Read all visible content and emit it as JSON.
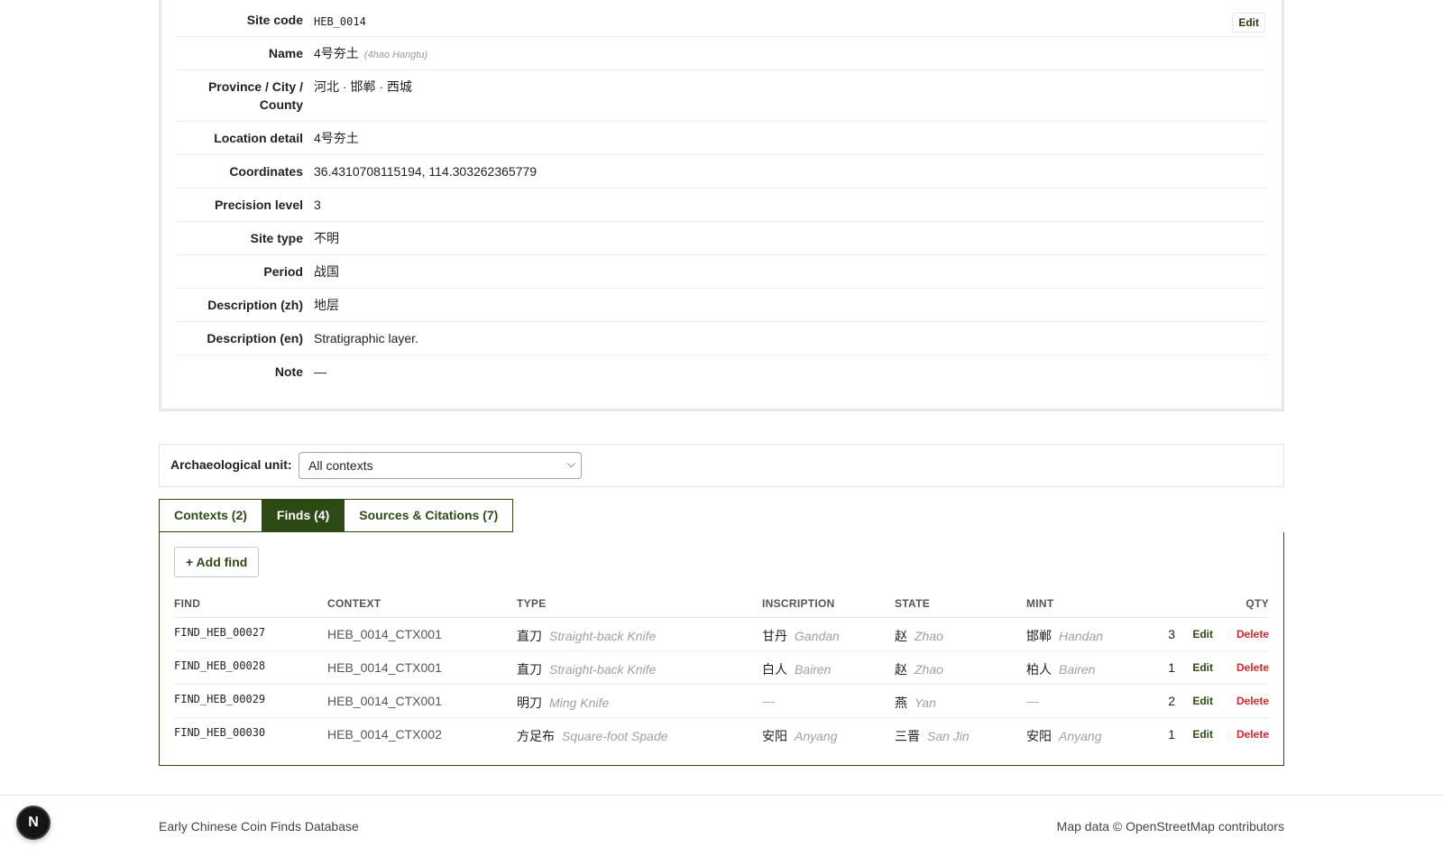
{
  "site": {
    "edit_label": "Edit",
    "fields": [
      {
        "label": "Site code",
        "value": "HEB_0014"
      },
      {
        "label": "Name",
        "value": "4号夯土",
        "sub": "(4hao Hangtu)"
      },
      {
        "label": "Province / City / County",
        "value": "河北 · 邯郸 · 西城"
      },
      {
        "label": "Location detail",
        "value": "4号夯土"
      },
      {
        "label": "Coordinates",
        "value": "36.4310708115194, 114.303262365779"
      },
      {
        "label": "Precision level",
        "value": "3"
      },
      {
        "label": "Site type",
        "value": "不明"
      },
      {
        "label": "Period",
        "value": "战国"
      },
      {
        "label": "Description (zh)",
        "value": "地层"
      },
      {
        "label": "Description (en)",
        "value": "Stratigraphic layer."
      },
      {
        "label": "Note",
        "value": "—"
      }
    ]
  },
  "unit_filter": {
    "label": "Archaeological unit:",
    "selected": "All contexts"
  },
  "tabs": [
    {
      "label": "Contexts (2)",
      "active": false
    },
    {
      "label": "Finds (4)",
      "active": true
    },
    {
      "label": "Sources & Citations (7)",
      "active": false
    }
  ],
  "finds": {
    "add_label": "+ Add find",
    "columns": [
      "FIND",
      "CONTEXT",
      "TYPE",
      "INSCRIPTION",
      "STATE",
      "MINT",
      "QTY"
    ],
    "row_actions": {
      "edit": "Edit",
      "delete": "Delete"
    },
    "rows": [
      {
        "find": "FIND_HEB_00027",
        "context": "HEB_0014_CTX001",
        "type_zh": "直刀",
        "type_en": "Straight-back Knife",
        "inscription_zh": "甘丹",
        "inscription_en": "Gandan",
        "state_zh": "赵",
        "state_en": "Zhao",
        "mint_zh": "邯郸",
        "mint_en": "Handan",
        "qty": "3"
      },
      {
        "find": "FIND_HEB_00028",
        "context": "HEB_0014_CTX001",
        "type_zh": "直刀",
        "type_en": "Straight-back Knife",
        "inscription_zh": "白人",
        "inscription_en": "Bairen",
        "state_zh": "赵",
        "state_en": "Zhao",
        "mint_zh": "柏人",
        "mint_en": "Bairen",
        "qty": "1"
      },
      {
        "find": "FIND_HEB_00029",
        "context": "HEB_0014_CTX001",
        "type_zh": "明刀",
        "type_en": "Ming Knife",
        "inscription_zh": "—",
        "inscription_en": "",
        "state_zh": "燕",
        "state_en": "Yan",
        "mint_zh": "—",
        "mint_en": "",
        "qty": "2"
      },
      {
        "find": "FIND_HEB_00030",
        "context": "HEB_0014_CTX002",
        "type_zh": "方足布",
        "type_en": "Square-foot Spade",
        "inscription_zh": "安阳",
        "inscription_en": "Anyang",
        "state_zh": "三晋",
        "state_en": "San Jin",
        "mint_zh": "安阳",
        "mint_en": "Anyang",
        "qty": "1"
      }
    ]
  },
  "footer": {
    "left": "Early Chinese Coin Finds Database",
    "right": "Map data © OpenStreetMap contributors"
  },
  "dev_badge": {
    "letter": "N",
    "icon": "nextjs-logo-icon"
  },
  "colors": {
    "accent": "#2e4a14",
    "danger": "#d9262b",
    "card_border": "#e3eaea"
  }
}
